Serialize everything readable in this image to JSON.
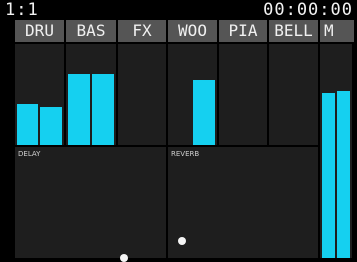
{
  "status": {
    "position": "1:1",
    "timecode": "00:00:00"
  },
  "tracks": [
    {
      "label": "DRU",
      "meter_levels": [
        0.41,
        0.38
      ]
    },
    {
      "label": "BAS",
      "meter_levels": [
        0.7,
        0.7
      ]
    },
    {
      "label": "FX",
      "meter_levels": [
        0,
        0
      ]
    },
    {
      "label": "WOO",
      "meter_levels": [
        0,
        0.64
      ]
    },
    {
      "label": "PIA",
      "meter_levels": [
        0,
        0
      ]
    },
    {
      "label": "BELL",
      "meter_levels": [
        0,
        0
      ]
    },
    {
      "label": "M",
      "meter_levels": [
        0.77,
        0.78
      ]
    }
  ],
  "effects": {
    "delay": {
      "label": "DELAY",
      "dot_x": 0.72,
      "dot_y": 1.0
    },
    "reverb": {
      "label": "REVERB",
      "dot_x": 0.09,
      "dot_y": 0.85
    }
  },
  "colors": {
    "meter": "#15d0f0",
    "label_bg": "#555555",
    "panel_bg": "#1e1e1e"
  }
}
